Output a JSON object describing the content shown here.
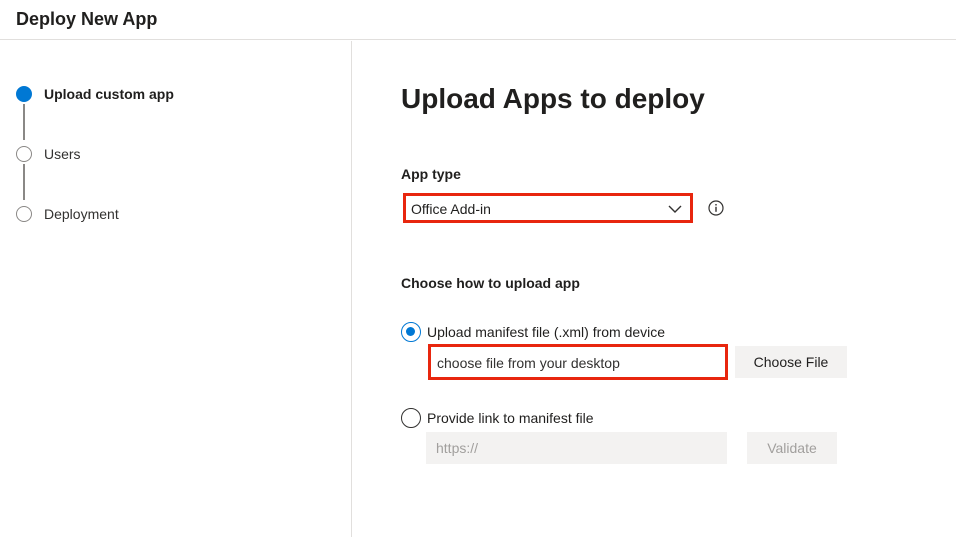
{
  "header": {
    "title": "Deploy New App"
  },
  "steps": [
    {
      "label": "Upload custom app",
      "active": true
    },
    {
      "label": "Users",
      "active": false
    },
    {
      "label": "Deployment",
      "active": false
    }
  ],
  "main": {
    "title": "Upload Apps to deploy",
    "app_type": {
      "label": "App type",
      "selected": "Office Add-in",
      "info_icon": "info-icon"
    },
    "upload": {
      "label": "Choose how to upload app",
      "option_file": {
        "label": "Upload manifest file (.xml) from device",
        "checked": true,
        "input_value": "choose file from your desktop",
        "button_label": "Choose File"
      },
      "option_link": {
        "label": "Provide link to manifest file",
        "checked": false,
        "placeholder": "https://",
        "button_label": "Validate"
      }
    }
  },
  "colors": {
    "accent": "#0078d4",
    "highlight": "#e8260e",
    "disabled_bg": "#f3f2f1"
  }
}
